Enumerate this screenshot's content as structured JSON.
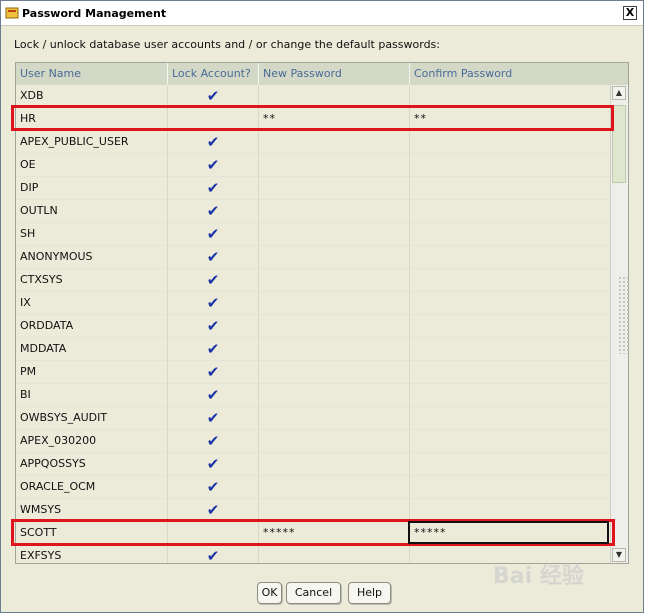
{
  "window": {
    "title": "Password Management",
    "close_label": "X"
  },
  "instruction": "Lock / unlock database user accounts and / or change the default passwords:",
  "table": {
    "columns": [
      "User Name",
      "Lock Account?",
      "New Password",
      "Confirm Password"
    ],
    "rows": [
      {
        "user": "XDB",
        "locked": true,
        "new_password": "",
        "confirm_password": ""
      },
      {
        "user": "HR",
        "locked": false,
        "new_password": "**",
        "confirm_password": "**"
      },
      {
        "user": "APEX_PUBLIC_USER",
        "locked": true,
        "new_password": "",
        "confirm_password": ""
      },
      {
        "user": "OE",
        "locked": true,
        "new_password": "",
        "confirm_password": ""
      },
      {
        "user": "DIP",
        "locked": true,
        "new_password": "",
        "confirm_password": ""
      },
      {
        "user": "OUTLN",
        "locked": true,
        "new_password": "",
        "confirm_password": ""
      },
      {
        "user": "SH",
        "locked": true,
        "new_password": "",
        "confirm_password": ""
      },
      {
        "user": "ANONYMOUS",
        "locked": true,
        "new_password": "",
        "confirm_password": ""
      },
      {
        "user": "CTXSYS",
        "locked": true,
        "new_password": "",
        "confirm_password": ""
      },
      {
        "user": "IX",
        "locked": true,
        "new_password": "",
        "confirm_password": ""
      },
      {
        "user": "ORDDATA",
        "locked": true,
        "new_password": "",
        "confirm_password": ""
      },
      {
        "user": "MDDATA",
        "locked": true,
        "new_password": "",
        "confirm_password": ""
      },
      {
        "user": "PM",
        "locked": true,
        "new_password": "",
        "confirm_password": ""
      },
      {
        "user": "BI",
        "locked": true,
        "new_password": "",
        "confirm_password": ""
      },
      {
        "user": "OWBSYS_AUDIT",
        "locked": true,
        "new_password": "",
        "confirm_password": ""
      },
      {
        "user": "APEX_030200",
        "locked": true,
        "new_password": "",
        "confirm_password": ""
      },
      {
        "user": "APPQOSSYS",
        "locked": true,
        "new_password": "",
        "confirm_password": ""
      },
      {
        "user": "ORACLE_OCM",
        "locked": true,
        "new_password": "",
        "confirm_password": ""
      },
      {
        "user": "WMSYS",
        "locked": true,
        "new_password": "",
        "confirm_password": ""
      },
      {
        "user": "SCOTT",
        "locked": false,
        "new_password": "*****",
        "confirm_password": "*****"
      },
      {
        "user": "EXFSYS",
        "locked": true,
        "new_password": "",
        "confirm_password": ""
      }
    ],
    "check_glyph": "✔"
  },
  "buttons": {
    "ok": "OK",
    "cancel": "Cancel",
    "help": "Help"
  },
  "watermark": "Bai 经验",
  "colors": {
    "highlight": "#e0141c",
    "check": "#1a34a8",
    "header_text": "#4a6a99"
  }
}
